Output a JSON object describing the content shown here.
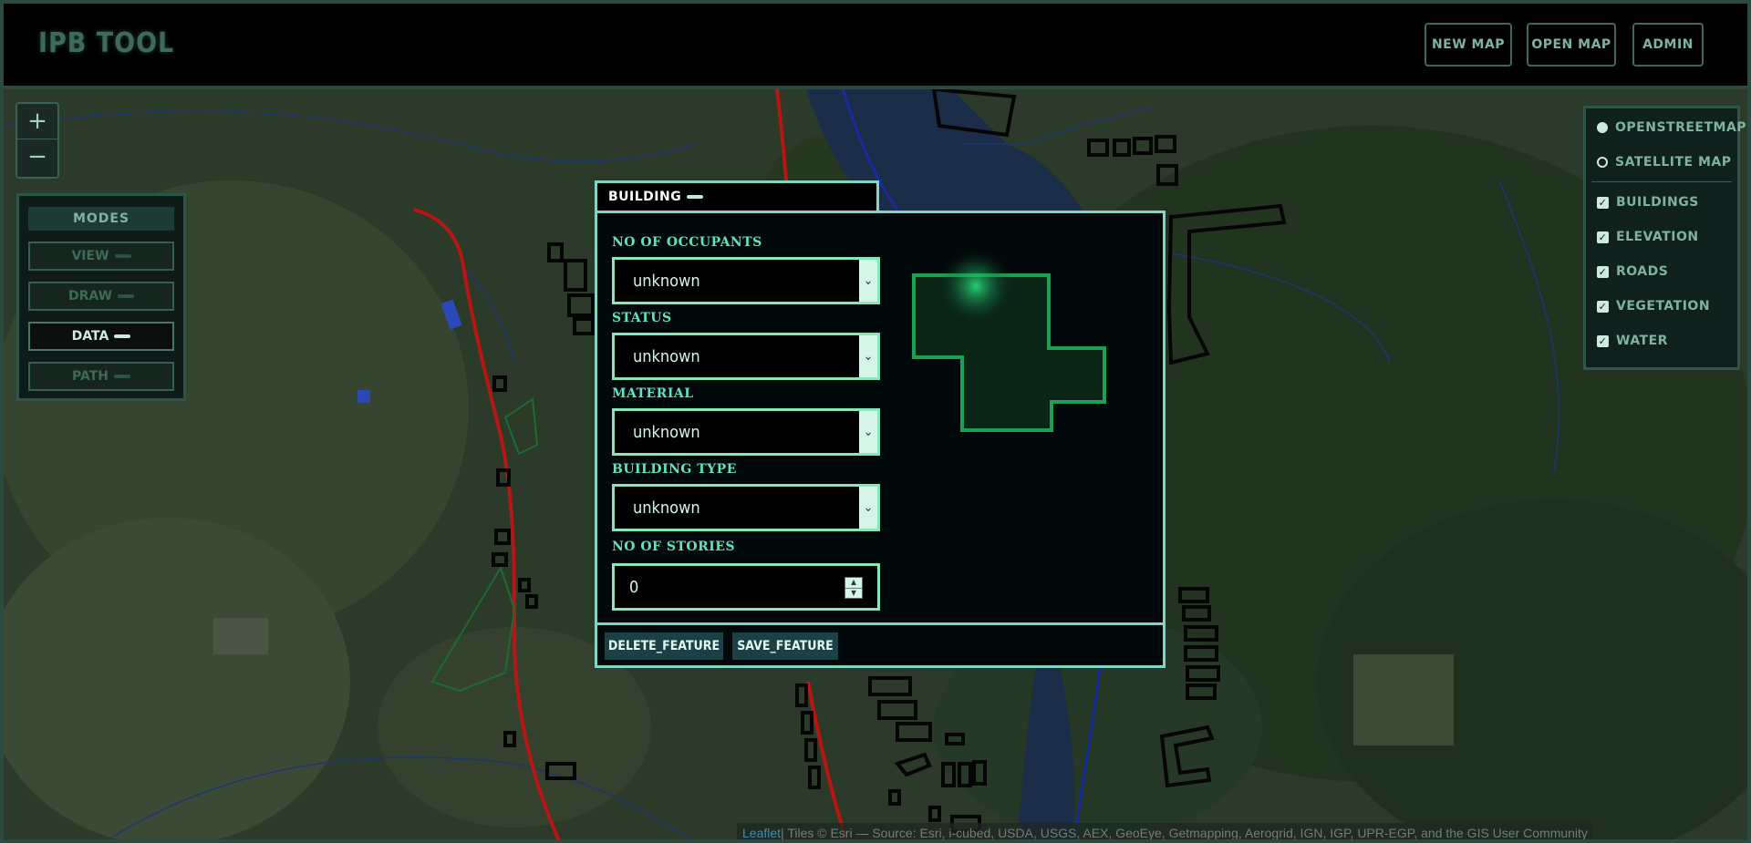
{
  "app": {
    "title": "IPB TOOL"
  },
  "header": {
    "buttons": [
      "NEW MAP",
      "OPEN MAP",
      "ADMIN"
    ]
  },
  "zoom": {
    "in": "+",
    "out": "−"
  },
  "modes": {
    "title": "MODES",
    "items": [
      {
        "label": "VIEW",
        "active": false
      },
      {
        "label": "DRAW",
        "active": false
      },
      {
        "label": "DATA",
        "active": true
      },
      {
        "label": "PATH",
        "active": false
      }
    ]
  },
  "layers": {
    "base": [
      {
        "label": "OPENSTREETMAP",
        "selected": true
      },
      {
        "label": "SATELLITE MAP",
        "selected": false
      }
    ],
    "overlays": [
      {
        "label": "BUILDINGS",
        "checked": true
      },
      {
        "label": "ELEVATION",
        "checked": true
      },
      {
        "label": "ROADS",
        "checked": true
      },
      {
        "label": "VEGETATION",
        "checked": true
      },
      {
        "label": "WATER",
        "checked": true
      }
    ]
  },
  "dialog": {
    "tab": "BUILDING",
    "fields": [
      {
        "label": "NO OF OCCUPANTS",
        "value": "unknown"
      },
      {
        "label": "STATUS",
        "value": "unknown"
      },
      {
        "label": "MATERIAL",
        "value": "unknown"
      },
      {
        "label": "BUILDING TYPE",
        "value": "unknown"
      }
    ],
    "stories": {
      "label": "NO OF STORIES",
      "value": "0"
    },
    "buttons": {
      "delete": "DELETE_FEATURE",
      "save": "SAVE_FEATURE"
    }
  },
  "attribution": {
    "link": "Leaflet",
    "text": " | Tiles © Esri — Source: Esri, i-cubed, USDA, USGS, AEX, GeoEye, Getmapping, Aerogrid, IGN, IGP, UPR-EGP, and the GIS User Community"
  },
  "colors": {
    "accent": "#7fd6c2",
    "label": "#5de4c0",
    "road": "#c01818",
    "river": "#1d2b8a",
    "building_outline": "#0a0a0a",
    "vegetation_outline": "#1f6a30"
  }
}
